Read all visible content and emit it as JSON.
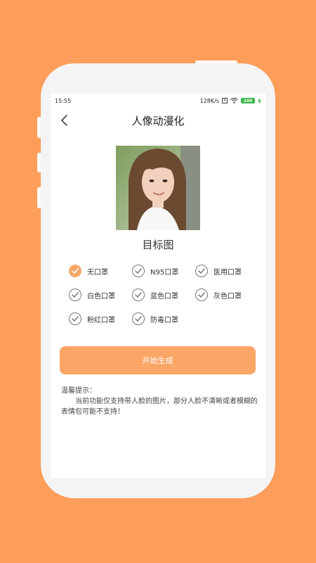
{
  "status": {
    "time": "15:55",
    "speed": "128K/s",
    "battery": "100"
  },
  "header": {
    "title": "人像动漫化"
  },
  "image": {
    "caption": "目标图"
  },
  "options": [
    {
      "label": "无口罩",
      "checked": true
    },
    {
      "label": "N95口罩",
      "checked": false
    },
    {
      "label": "医用口罩",
      "checked": false
    },
    {
      "label": "白色口罩",
      "checked": false
    },
    {
      "label": "蓝色口罩",
      "checked": false
    },
    {
      "label": "灰色口罩",
      "checked": false
    },
    {
      "label": "粉红口罩",
      "checked": false
    },
    {
      "label": "防毒口罩",
      "checked": false
    }
  ],
  "actions": {
    "start_label": "开始生成"
  },
  "tips": {
    "title": "温馨提示：",
    "body": "当前功能仅支持带人脸的图片，部分人脸不清晰或者模糊的表情包可能不支持！"
  },
  "colors": {
    "background": "#FF9E5A",
    "accent": "#FBA566",
    "battery": "#3BB54A"
  }
}
